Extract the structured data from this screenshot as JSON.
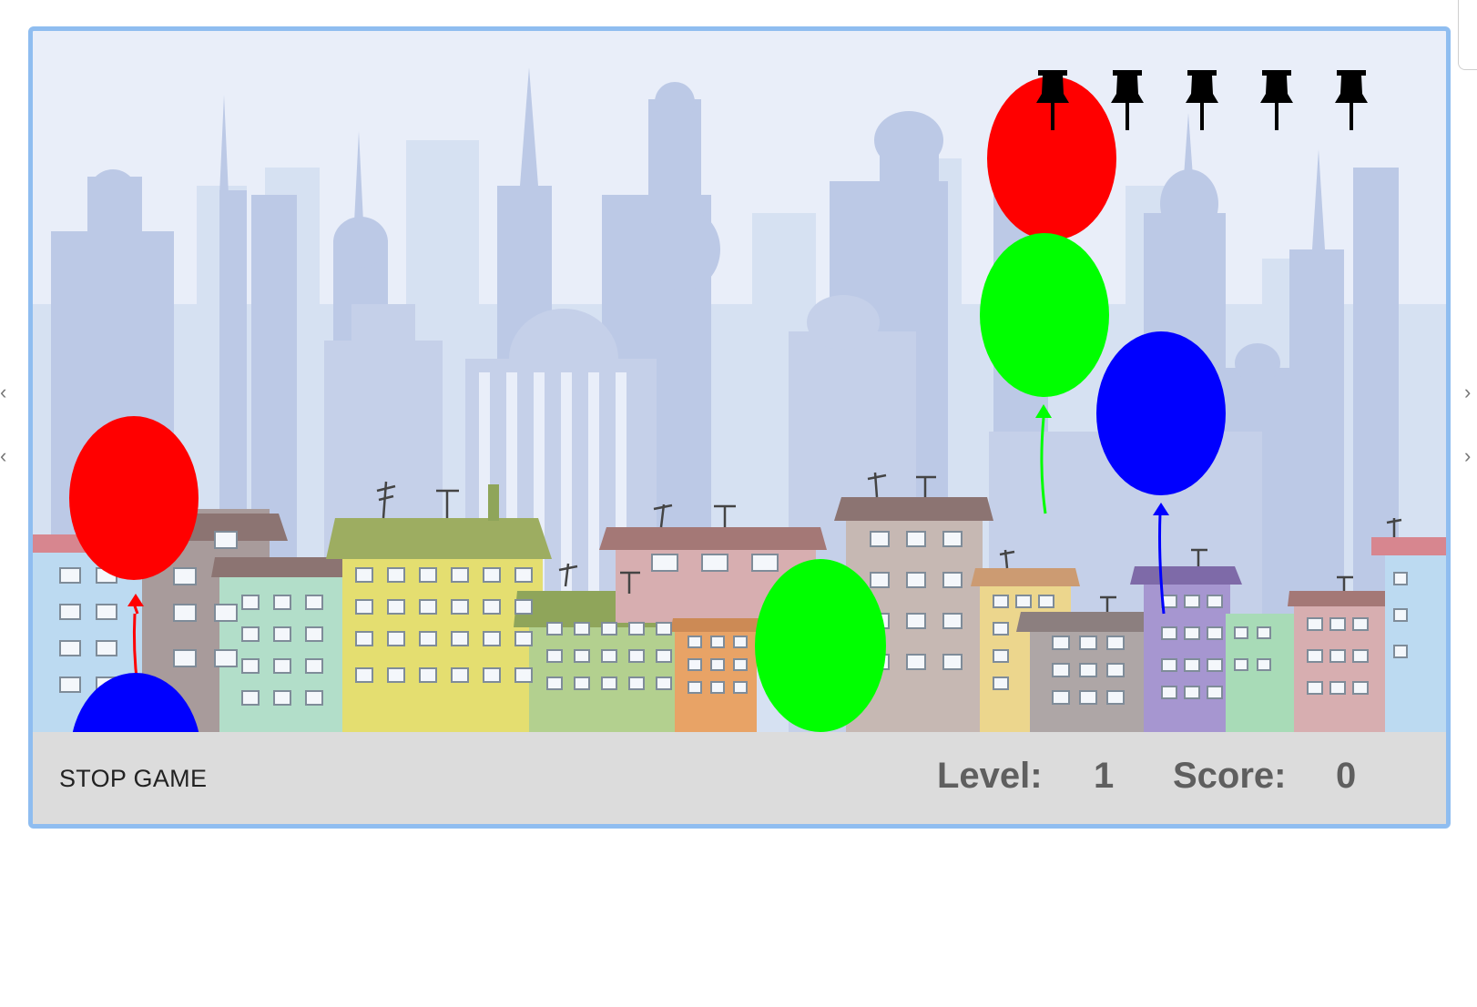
{
  "game": {
    "stop_label": "STOP GAME",
    "level_label": "Level:",
    "level_value": "1",
    "score_label": "Score:",
    "score_value": "0",
    "pins_remaining": 5
  },
  "balloons": [
    {
      "color": "#ff0000"
    },
    {
      "color": "#0000ff"
    },
    {
      "color": "#00ff00"
    },
    {
      "color": "#ff0000"
    },
    {
      "color": "#00ff00"
    },
    {
      "color": "#0000ff"
    }
  ],
  "colors": {
    "frame": "#8fbdf0",
    "sky": "#e9eef9",
    "bottom_bar": "#dcdcdc",
    "hud_text": "#5f5f5f"
  },
  "icons": [
    "pushpin-icon",
    "chevron-left-icon",
    "chevron-right-icon"
  ]
}
